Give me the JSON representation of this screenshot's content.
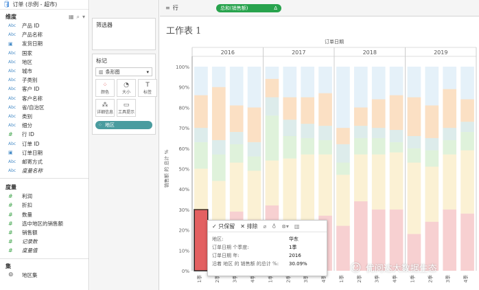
{
  "datasource": {
    "label": "订单 (示例 - 超市)"
  },
  "dimensions": {
    "title": "维度",
    "fields": [
      {
        "type": "abc",
        "label": "产品 ID",
        "italic": false
      },
      {
        "type": "abc",
        "label": "产品名称",
        "italic": false
      },
      {
        "type": "date",
        "label": "发货日期",
        "italic": false
      },
      {
        "type": "abc",
        "label": "国家",
        "italic": false
      },
      {
        "type": "abc",
        "label": "地区",
        "italic": false
      },
      {
        "type": "abc",
        "label": "城市",
        "italic": false
      },
      {
        "type": "abc",
        "label": "子类别",
        "italic": false
      },
      {
        "type": "abc",
        "label": "客户 ID",
        "italic": false
      },
      {
        "type": "abc",
        "label": "客户名称",
        "italic": false
      },
      {
        "type": "abc",
        "label": "省/自治区",
        "italic": false
      },
      {
        "type": "abc",
        "label": "类别",
        "italic": false
      },
      {
        "type": "abc",
        "label": "细分",
        "italic": false
      },
      {
        "type": "num",
        "label": "行 ID",
        "italic": false
      },
      {
        "type": "abc",
        "label": "订单 ID",
        "italic": false
      },
      {
        "type": "date",
        "label": "订单日期",
        "italic": false
      },
      {
        "type": "abc",
        "label": "邮寄方式",
        "italic": false
      },
      {
        "type": "abc",
        "label": "度量名称",
        "italic": true
      }
    ]
  },
  "measures": {
    "title": "度量",
    "fields": [
      {
        "label": "利润",
        "italic": false
      },
      {
        "label": "折扣",
        "italic": false
      },
      {
        "label": "数量",
        "italic": false
      },
      {
        "label": "选中地区的销售额",
        "italic": false
      },
      {
        "label": "销售额",
        "italic": false
      },
      {
        "label": "记录数",
        "italic": true
      },
      {
        "label": "度量值",
        "italic": true
      }
    ]
  },
  "sets": {
    "title": "集",
    "fields": [
      {
        "label": "地区集"
      }
    ]
  },
  "filters": {
    "title": "筛选器"
  },
  "marks": {
    "title": "标记",
    "type_label": "条形图",
    "buttons": [
      {
        "label": "颜色",
        "icon": "color-dots-icon"
      },
      {
        "label": "大小",
        "icon": "size-icon"
      },
      {
        "label": "标签",
        "icon": "label-icon"
      },
      {
        "label": "详细信息",
        "icon": "detail-icon"
      },
      {
        "label": "工具提示",
        "icon": "tooltip-icon"
      }
    ],
    "color_pill": "地区"
  },
  "rows_shelf": {
    "label": "行",
    "pill": "总和(销售额)",
    "pill_delta": "Δ"
  },
  "sheet": {
    "title": "工作表 1"
  },
  "tooltip": {
    "toolbar": {
      "keep": "只保留",
      "exclude": "排除"
    },
    "rows": [
      {
        "key": "地区:",
        "value": "华东"
      },
      {
        "key": "订单日期 个季度:",
        "value": "1季"
      },
      {
        "key": "订单日期 年:",
        "value": "2016"
      },
      {
        "key": "沿着 地区 的 销售额 的总计 %:",
        "value": "30.09%"
      }
    ]
  },
  "watermark": {
    "text": "优阅达大数据生态"
  },
  "chart_data": {
    "type": "bar",
    "stacked": true,
    "title": "",
    "column_header": "订单日期",
    "years": [
      "2016",
      "2017",
      "2018",
      "2019"
    ],
    "quarters": [
      "1季",
      "2季",
      "3季",
      "4季"
    ],
    "ylabel": "销售额 的 总计 %",
    "ylim": [
      0,
      100
    ],
    "yticks": [
      "0%",
      "10%",
      "20%",
      "30%",
      "40%",
      "50%",
      "60%",
      "70%",
      "80%",
      "90%",
      "100%"
    ],
    "series_colors": [
      "#e15759",
      "#f1ce63",
      "#8cd17d",
      "#86bcb6",
      "#f28e2b",
      "#a0cbe8"
    ],
    "highlight": {
      "year_index": 0,
      "quarter_index": 0
    },
    "series": [
      {
        "values": [
          30,
          21,
          29,
          25,
          32,
          24,
          22,
          27,
          22,
          34,
          30,
          30,
          18,
          24,
          30,
          28
        ]
      },
      {
        "values": [
          20,
          23,
          24,
          24,
          22,
          31,
          35,
          30,
          25,
          23,
          27,
          28,
          35,
          27,
          27,
          31
        ]
      },
      {
        "values": [
          13,
          13,
          9,
          7,
          22,
          11,
          8,
          7,
          6,
          8,
          8,
          5,
          7,
          8,
          7,
          9
        ]
      },
      {
        "values": [
          7,
          7,
          6,
          7,
          9,
          8,
          7,
          7,
          9,
          6,
          5,
          6,
          6,
          6,
          6,
          5
        ]
      },
      {
        "values": [
          16,
          26,
          13,
          17,
          9,
          11,
          13,
          16,
          8,
          9,
          14,
          17,
          19,
          16,
          19,
          11
        ]
      },
      {
        "values": [
          14,
          10,
          19,
          20,
          6,
          15,
          15,
          13,
          30,
          20,
          16,
          14,
          15,
          19,
          11,
          16
        ]
      }
    ]
  }
}
